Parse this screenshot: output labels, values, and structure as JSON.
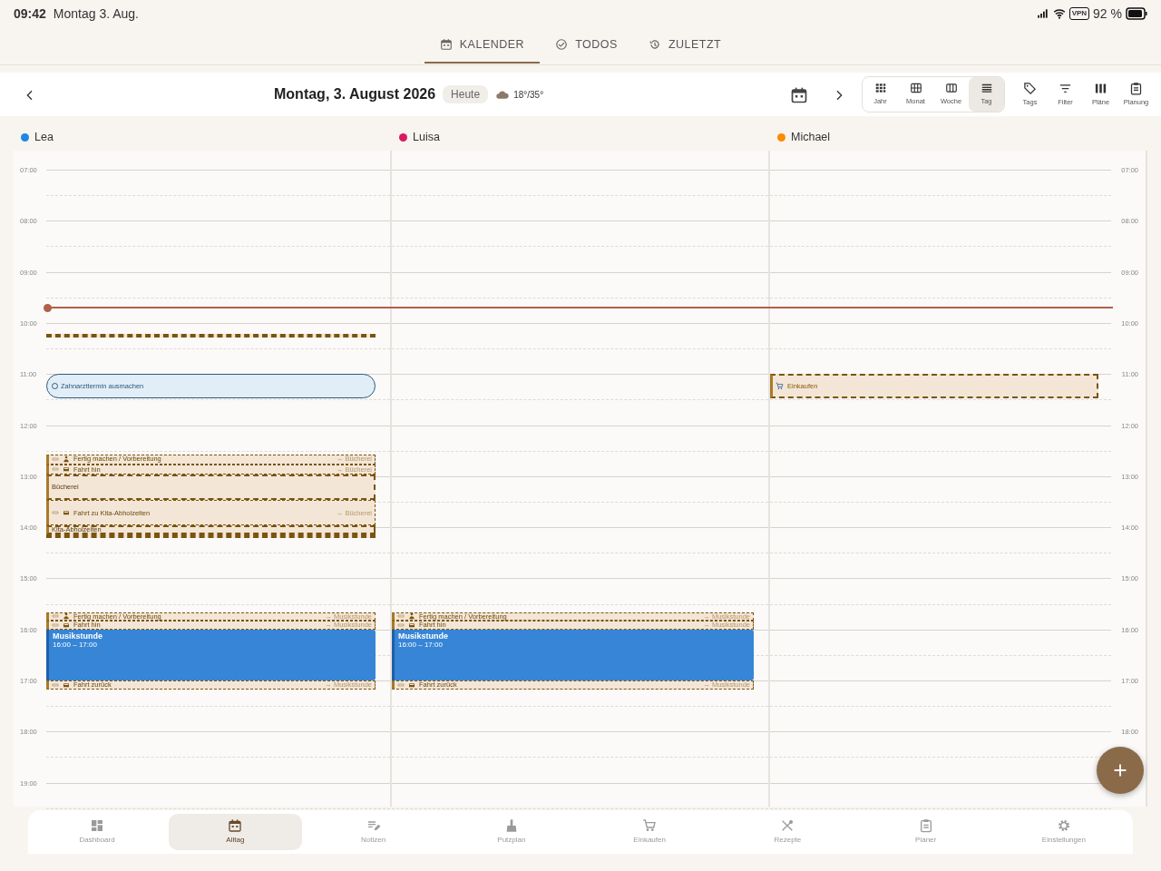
{
  "status_bar": {
    "time": "09:42",
    "date": "Montag 3. Aug.",
    "vpn": "VPN",
    "battery": "92 %"
  },
  "tabs": [
    {
      "label": "KALENDER",
      "selected": true
    },
    {
      "label": "TODOS",
      "selected": false
    },
    {
      "label": "ZULETZT",
      "selected": false
    }
  ],
  "toolbar": {
    "title": "Montag, 3. August 2026",
    "today": "Heute",
    "weather": "18°/35°",
    "views": [
      {
        "label": "Jahr",
        "selected": false
      },
      {
        "label": "Monat",
        "selected": false
      },
      {
        "label": "Woche",
        "selected": false
      },
      {
        "label": "Tag",
        "selected": true
      }
    ],
    "tools": [
      {
        "label": "Tags"
      },
      {
        "label": "Filter"
      },
      {
        "label": "Pläne"
      },
      {
        "label": "Planung"
      }
    ]
  },
  "hours_left": [
    "07:00",
    "08:00",
    "09:00",
    "10:00",
    "11:00",
    "12:00",
    "13:00",
    "14:00",
    "15:00",
    "16:00",
    "17:00",
    "18:00",
    "19:00"
  ],
  "hours_right": [
    "07:00",
    "08:00",
    "09:00",
    "10:00",
    "11:00",
    "12:00",
    "13:00",
    "14:00",
    "15:00",
    "16:00",
    "17:00",
    "18:00"
  ],
  "columns": [
    {
      "name": "Lea",
      "color": "#1e88e5",
      "events": [
        {
          "kind": "stripe"
        },
        {
          "kind": "todo",
          "title": "Zahnarzttermin ausmachen"
        },
        {
          "kind": "prep",
          "title": "Fertig machen / Vorbereitung",
          "target": "→ Bücherei"
        },
        {
          "kind": "travel",
          "title": "Fahrt hin",
          "target": "→ Bücherei"
        },
        {
          "kind": "place",
          "title": "Bücherei"
        },
        {
          "kind": "travel",
          "title": "Fahrt zu Kita-Abholzeiten",
          "target": "→ Bücherei"
        },
        {
          "kind": "place",
          "title": "Kita-Abholzeiten"
        },
        {
          "kind": "stripe"
        },
        {
          "kind": "prep",
          "title": "Fertig machen / Vorbereitung",
          "target": "→ Musikstunde"
        },
        {
          "kind": "travel",
          "title": "Fahrt hin",
          "target": "→ Musikstunde"
        },
        {
          "kind": "music",
          "title": "Musikstunde",
          "time": "16:00 – 17:00"
        },
        {
          "kind": "travel",
          "title": "Fahrt zurück",
          "target": "→ Musikstunde"
        }
      ]
    },
    {
      "name": "Luisa",
      "color": "#d81b60",
      "events": [
        {
          "kind": "prep",
          "title": "Fertig machen / Vorbereitung",
          "target": "→ Musikstunde"
        },
        {
          "kind": "travel",
          "title": "Fahrt hin",
          "target": "→ Musikstunde"
        },
        {
          "kind": "music",
          "title": "Musikstunde",
          "time": "16:00 – 17:00"
        },
        {
          "kind": "travel",
          "title": "Fahrt zurück",
          "target": "→ Musikstunde"
        }
      ]
    },
    {
      "name": "Michael",
      "color": "#fb8c00",
      "events": [
        {
          "kind": "shopping",
          "title": "Einkaufen"
        }
      ]
    }
  ],
  "nav": [
    {
      "label": "Dashboard",
      "selected": false
    },
    {
      "label": "Alltag",
      "selected": true
    },
    {
      "label": "Notizen",
      "selected": false
    },
    {
      "label": "Putzplan",
      "selected": false
    },
    {
      "label": "Einkaufen",
      "selected": false
    },
    {
      "label": "Rezepte",
      "selected": false
    },
    {
      "label": "Planer",
      "selected": false
    },
    {
      "label": "Einstellungen",
      "selected": false
    }
  ]
}
